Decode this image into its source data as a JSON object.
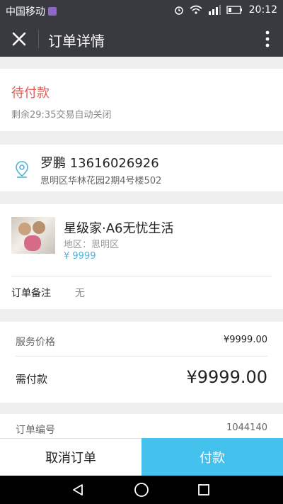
{
  "status_bar": {
    "carrier": "中国移动",
    "time": "20:12"
  },
  "app_bar": {
    "title": "订单详情",
    "icons": [
      "close-icon",
      "more-icon"
    ]
  },
  "order_status": {
    "title": "待付款",
    "subtitle": "剩余29:35交易自动关闭"
  },
  "address": {
    "name_phone": "罗鹏 13616026926",
    "detail": "思明区华林花园2期4号楼502"
  },
  "product": {
    "name": "星级家·A6无忧生活",
    "region": "地区：思明区",
    "price": "¥ 9999"
  },
  "remark": {
    "label": "订单备注",
    "value": "无"
  },
  "pricing": {
    "service_label": "服务价格",
    "service_value": "¥9999.00",
    "due_label": "需付款",
    "due_value": "¥9999.00"
  },
  "order_info": {
    "number_label": "订单编号",
    "number_value": "1044140"
  },
  "actions": {
    "cancel_label": "取消订单",
    "pay_label": "付款"
  },
  "colors": {
    "accent": "#44c1ec",
    "warning": "#e15b58",
    "topbar": "#393a3f"
  }
}
